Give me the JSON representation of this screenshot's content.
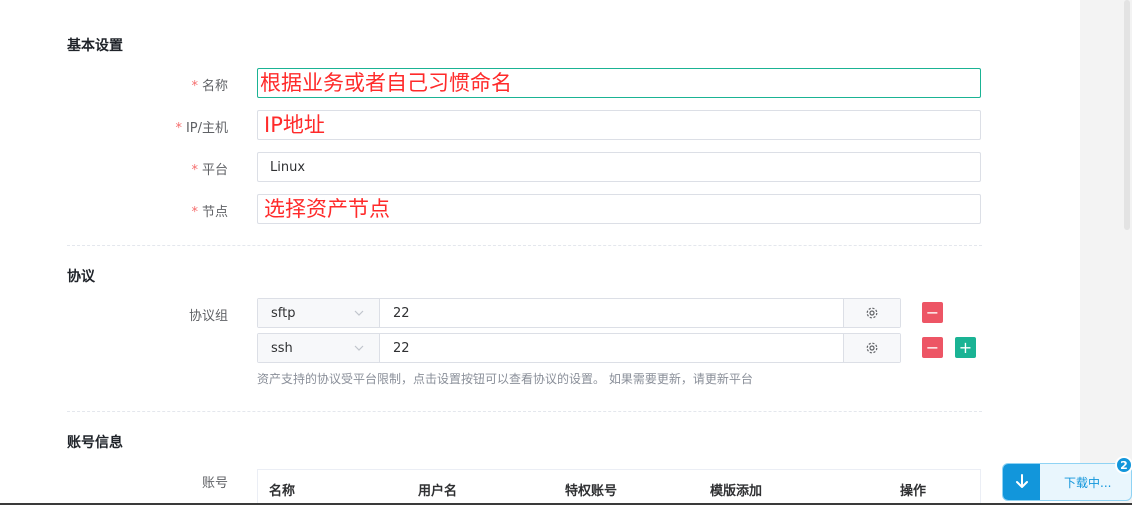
{
  "basic": {
    "title": "基本设置",
    "name_label": "名称",
    "name_value": "根据业务或者自己习惯命名",
    "ip_label": "IP/主机",
    "ip_value": "IP地址",
    "platform_label": "平台",
    "platform_value": "Linux",
    "node_label": "节点",
    "node_value": "选择资产节点",
    "required_mark": "*"
  },
  "protocol": {
    "title": "协议",
    "group_label": "协议组",
    "rows": [
      {
        "name": "sftp",
        "port": "22"
      },
      {
        "name": "ssh",
        "port": "22"
      }
    ],
    "help": "资产支持的协议受平台限制，点击设置按钮可以查看协议的设置。 如果需要更新，请更新平台"
  },
  "account": {
    "title": "账号信息",
    "label": "账号",
    "columns": [
      "名称",
      "用户名",
      "特权账号",
      "模版添加",
      "操作"
    ]
  },
  "download": {
    "text": "下载中...",
    "badge": "2"
  },
  "colors": {
    "accent": "#1ab394",
    "danger": "#ed5565",
    "required": "#f56c6c",
    "annotation": "#ff2a2a",
    "download": "#1296db"
  },
  "icons": {
    "gear": "gear-icon",
    "chevron": "chevron-down-icon",
    "minus": "minus-icon",
    "plus": "plus-icon",
    "download": "download-arrow-icon"
  }
}
